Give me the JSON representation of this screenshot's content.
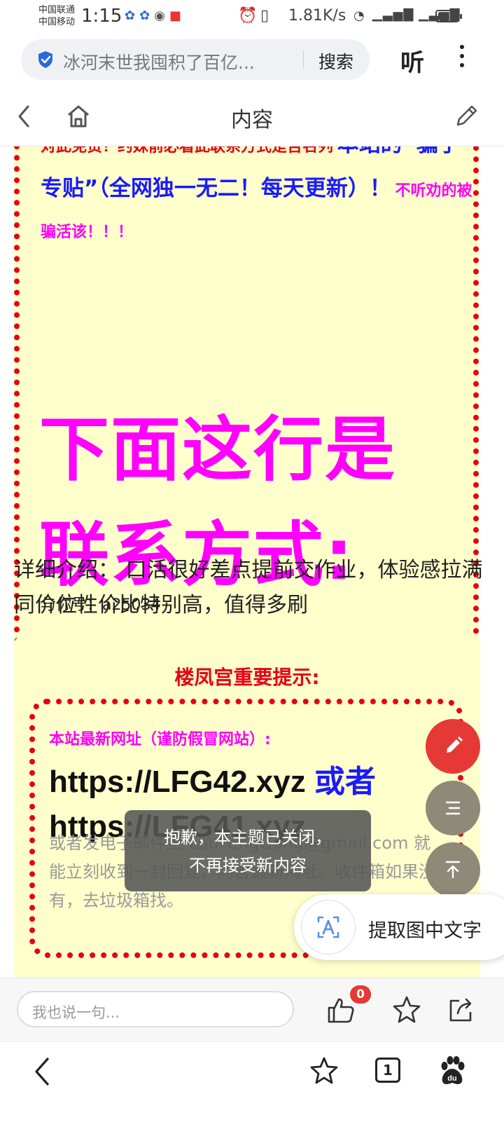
{
  "status_bar": {
    "carrier1": "中国联通",
    "carrier2": "中国移动",
    "time": "1:15",
    "speed": "1.81K/s"
  },
  "address_bar": {
    "text": "冰河末世我囤积了百亿...",
    "search_label": "搜索",
    "listen_label": "听"
  },
  "nav": {
    "title": "内容"
  },
  "post": {
    "notice_red": "对此免责！约妹前必看此联系方式是否名列",
    "notice_blue": "本站的“骗子专贴”（全网独一无二！每天更新）！",
    "notice_magenta": "不听劝的被骗活该！！！",
    "big_heading": "下面这行是联系方式:",
    "contact": "与你号：a25034",
    "description": "详细介绍： 口活很好差点提前交作业，体验感拉满同价位性价比特别高，值得多刷",
    "tip_title": "楼凤宫重要提示:",
    "tip_subtitle": "本站最新网址（谨防假冒网站）:",
    "url1": "https://LFG42.xyz",
    "url_or": "或者",
    "url2": "https://LFG41.xyz",
    "email_text": "或者发电子邮件至 LouFengGong@gmail.com 就能立刻收到一封回复，内含最新网址。收件箱如果没有，去垃圾箱找。"
  },
  "toast": {
    "line1": "抱歉，本主题已关闭，",
    "line2": "不再接受新内容"
  },
  "extract": {
    "label": "提取图中文字"
  },
  "comment_bar": {
    "placeholder": "我也说一句...",
    "like_count": "0"
  },
  "bottom_nav": {
    "tab_count": "1"
  },
  "colors": {
    "accent_red": "#e53935",
    "text_magenta": "#ff00ff",
    "text_blue": "#1a1aff",
    "box_bg": "#ffffcc",
    "border_red": "#e60012"
  }
}
